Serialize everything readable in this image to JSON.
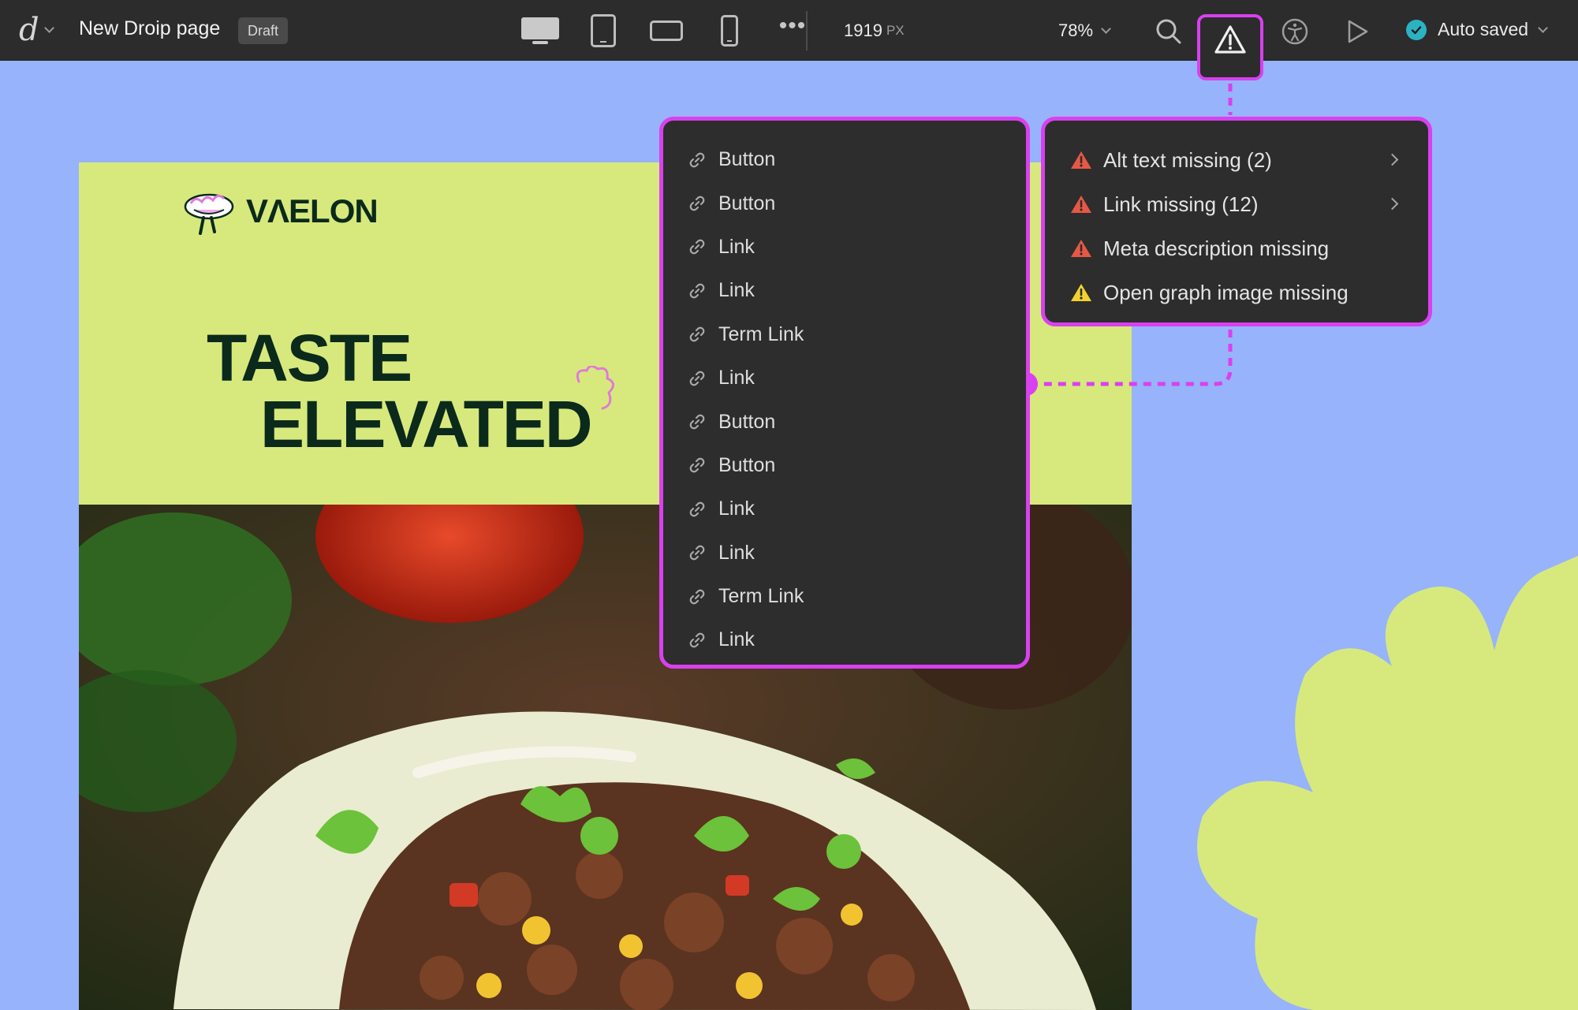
{
  "app": {
    "page_name": "New Droip page",
    "status_badge": "Draft",
    "width_value": "1919",
    "width_unit": "PX",
    "zoom": "78%",
    "save_status": "Auto saved"
  },
  "toolbar_icons": [
    "droip-logo-icon",
    "desktop-icon",
    "tablet-icon",
    "tablet-landscape-icon",
    "mobile-icon",
    "more-icon",
    "search-icon",
    "warning-icon",
    "accessibility-icon",
    "play-icon",
    "check-icon"
  ],
  "link_list": {
    "items": [
      "Button",
      "Button",
      "Link",
      "Link",
      "Term Link",
      "Link",
      "Button",
      "Button",
      "Link",
      "Link",
      "Term Link",
      "Link"
    ]
  },
  "issues": {
    "items": [
      {
        "label": "Alt text missing (2)",
        "severity": "error",
        "expandable": true
      },
      {
        "label": "Link missing (12)",
        "severity": "error",
        "expandable": true
      },
      {
        "label": "Meta description missing",
        "severity": "error",
        "expandable": false
      },
      {
        "label": "Open graph image missing",
        "severity": "warning",
        "expandable": false
      }
    ]
  },
  "canvas": {
    "brand": "VΛELON",
    "hero_line1": "TASTE",
    "hero_line2": "ELEVATED"
  },
  "colors": {
    "accent": "#d940ef",
    "error": "#e65845",
    "warning": "#f2d32e",
    "canvas_bg": "#97b3fb",
    "page_bg": "#d7e97d",
    "hero_text": "#0b2a1c",
    "saved_ok": "#2bb3c1"
  }
}
